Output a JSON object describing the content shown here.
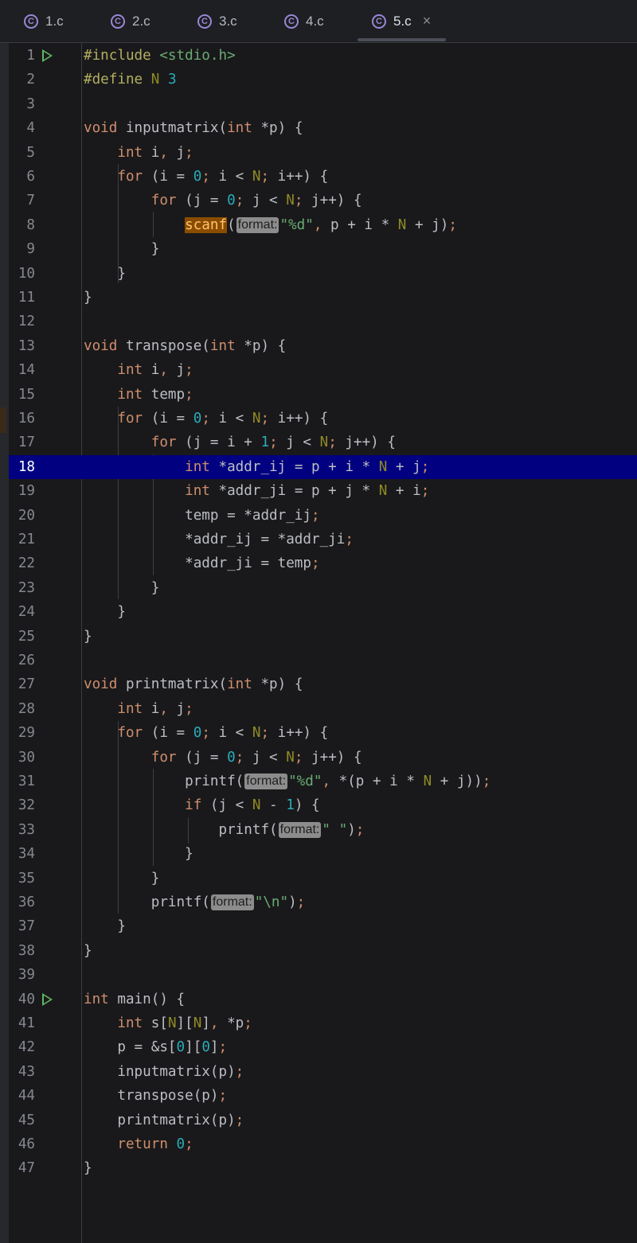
{
  "tabs": [
    {
      "label": "1.c",
      "icon": "c-file-icon",
      "active": false
    },
    {
      "label": "2.c",
      "icon": "c-file-icon",
      "active": false
    },
    {
      "label": "3.c",
      "icon": "c-file-icon",
      "active": false
    },
    {
      "label": "4.c",
      "icon": "c-file-icon",
      "active": false
    },
    {
      "label": "5.c",
      "icon": "c-file-icon",
      "active": true,
      "close": "×"
    }
  ],
  "file_icon_letter": "C",
  "highlighted_line": 18,
  "colors": {
    "keyword": "#cf8e6d",
    "string": "#6aab73",
    "number": "#2aacb8",
    "macro": "#908b25",
    "current_line": "#010080",
    "run_icon": "#5fb865"
  },
  "editor": {
    "run_markers": [
      1,
      40
    ],
    "line_numbers": [
      "1",
      "2",
      "3",
      "4",
      "5",
      "6",
      "7",
      "8",
      "9",
      "10",
      "11",
      "12",
      "13",
      "14",
      "15",
      "16",
      "17",
      "18",
      "19",
      "20",
      "21",
      "22",
      "23",
      "24",
      "25",
      "26",
      "27",
      "28",
      "29",
      "30",
      "31",
      "32",
      "33",
      "34",
      "35",
      "36",
      "37",
      "38",
      "39",
      "40",
      "41",
      "42",
      "43",
      "44",
      "45",
      "46",
      "47"
    ],
    "hints": {
      "format": "format:"
    },
    "code_lines": [
      "#include <stdio.h>",
      "#define N 3",
      "",
      "void inputmatrix(int *p) {",
      "    int i, j;",
      "    for (i = 0; i < N; i++) {",
      "        for (j = 0; j < N; j++) {",
      "            scanf(\"%d\", p + i * N + j);",
      "        }",
      "    }",
      "}",
      "",
      "void transpose(int *p) {",
      "    int i, j;",
      "    int temp;",
      "    for (i = 0; i < N; i++) {",
      "        for (j = i + 1; j < N; j++) {",
      "            int *addr_ij = p + i * N + j;",
      "            int *addr_ji = p + j * N + i;",
      "            temp = *addr_ij;",
      "            *addr_ij = *addr_ji;",
      "            *addr_ji = temp;",
      "        }",
      "    }",
      "}",
      "",
      "void printmatrix(int *p) {",
      "    int i, j;",
      "    for (i = 0; i < N; i++) {",
      "        for (j = 0; j < N; j++) {",
      "            printf(\"%d\", *(p + i * N + j));",
      "            if (j < N - 1) {",
      "                printf(\" \");",
      "            }",
      "        }",
      "        printf(\"\\n\");",
      "    }",
      "}",
      "",
      "int main() {",
      "    int s[N][N], *p;",
      "    p = &s[0][0];",
      "    inputmatrix(p);",
      "    transpose(p);",
      "    printmatrix(p);",
      "    return 0;",
      "}"
    ]
  }
}
